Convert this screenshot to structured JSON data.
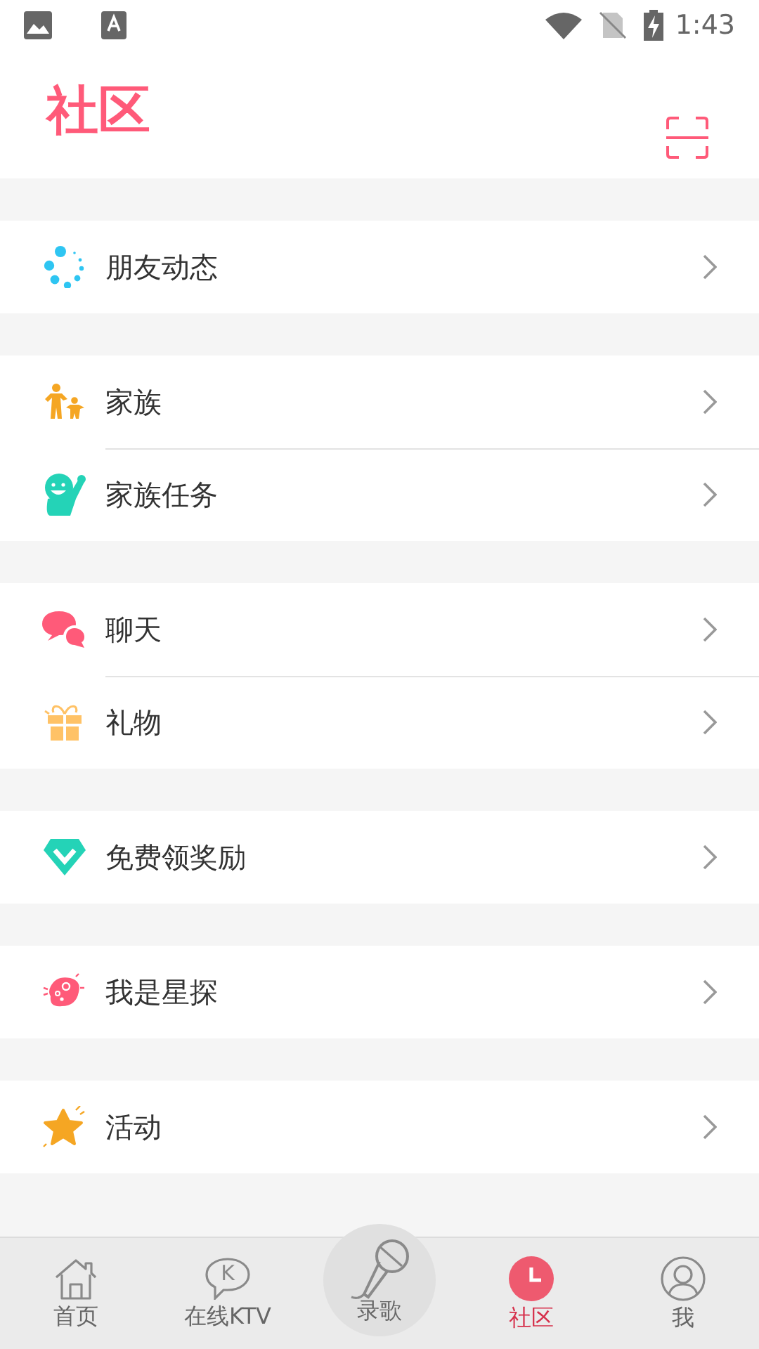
{
  "status_bar": {
    "time": "1:43"
  },
  "header": {
    "title": "社区"
  },
  "groups": [
    {
      "items": [
        {
          "kind": "moments",
          "label": "朋友动态"
        }
      ]
    },
    {
      "items": [
        {
          "kind": "family",
          "label": "家族"
        },
        {
          "kind": "task",
          "label": "家族任务"
        }
      ]
    },
    {
      "items": [
        {
          "kind": "chat",
          "label": "聊天"
        },
        {
          "kind": "gift",
          "label": "礼物"
        }
      ]
    },
    {
      "items": [
        {
          "kind": "reward",
          "label": "免费领奖励"
        }
      ]
    },
    {
      "items": [
        {
          "kind": "scout",
          "label": "我是星探"
        }
      ]
    },
    {
      "items": [
        {
          "kind": "event",
          "label": "活动"
        }
      ]
    }
  ],
  "bottom_nav": [
    {
      "kind": "home",
      "label": "首页",
      "selected": false
    },
    {
      "kind": "ktv",
      "label": "在线KTV",
      "icon_text": "K",
      "selected": false
    },
    {
      "kind": "record",
      "label": "录歌",
      "selected": false
    },
    {
      "kind": "community",
      "label": "社区",
      "selected": true
    },
    {
      "kind": "me",
      "label": "我",
      "selected": false
    }
  ]
}
